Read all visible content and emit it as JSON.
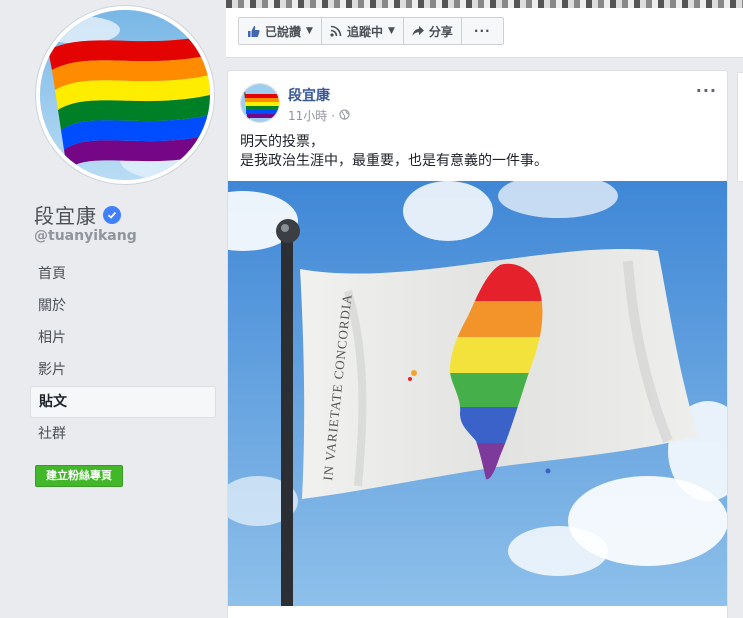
{
  "sidebar": {
    "page_name": "段宜康",
    "username": "@tuanyikang",
    "nav": [
      {
        "label": "首頁",
        "active": false
      },
      {
        "label": "關於",
        "active": false
      },
      {
        "label": "相片",
        "active": false
      },
      {
        "label": "影片",
        "active": false
      },
      {
        "label": "貼文",
        "active": true
      },
      {
        "label": "社群",
        "active": false
      }
    ],
    "create_page_label": "建立粉絲專頁"
  },
  "action_bar": {
    "liked_label": "已說讚",
    "following_label": "追蹤中",
    "share_label": "分享",
    "more_label": "···"
  },
  "post": {
    "author": "段宜康",
    "time": "11小時",
    "separator": "·",
    "text_line1": "明天的投票，",
    "text_line2": "是我政治生涯中，最重要，也是有意義的一件事。",
    "menu_label": "···",
    "flag_text": "IN VARIETATE CONCORDIA"
  },
  "colors": {
    "link_blue": "#385898",
    "fb_bg": "#e9ebee",
    "create_green": "#42b72a",
    "verified_blue": "#4080ff",
    "rainbow": [
      "#e40303",
      "#ff8c00",
      "#ffed00",
      "#008026",
      "#004dff",
      "#750787"
    ]
  },
  "icons": {
    "liked": "thumbs-up-icon",
    "following": "rss-icon",
    "share": "share-arrow-icon",
    "verified": "verified-badge-icon",
    "privacy": "globe-icon"
  }
}
